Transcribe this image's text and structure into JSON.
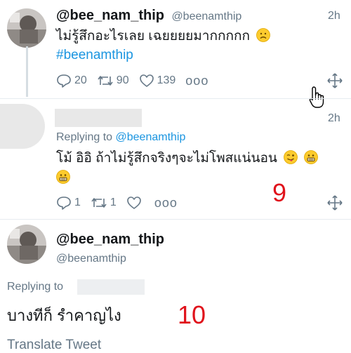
{
  "tweet1": {
    "display_name": "@bee_nam_thip",
    "handle": "@beenamthip",
    "time": "2h",
    "text": "ไม่รู้สึกอะไรเลย เฉยยยยมากกกกก",
    "hashtag": "#beenamthip",
    "replies": "20",
    "retweets": "90",
    "likes": "139",
    "more": "ooo",
    "emoji": "frown-face-icon"
  },
  "tweet2": {
    "time": "2h",
    "replying_prefix": "Replying to",
    "replying_handle": "@beenamthip",
    "text": "โม้ อิอิ ถ้าไม่รู้สึกจริงๆจะไม่โพสแน่นอน",
    "replies": "1",
    "retweets": "1",
    "more": "ooo",
    "annotation": "9"
  },
  "tweet3": {
    "display_name": "@bee_nam_thip",
    "handle": "@beenamthip",
    "replying_prefix": "Replying to",
    "text": "บางทีก็ รำคาญไง",
    "annotation": "10",
    "translate": "Translate Tweet"
  },
  "colors": {
    "link": "#1b95e0",
    "secondary": "#657786",
    "annotation_red": "#e0121b"
  }
}
